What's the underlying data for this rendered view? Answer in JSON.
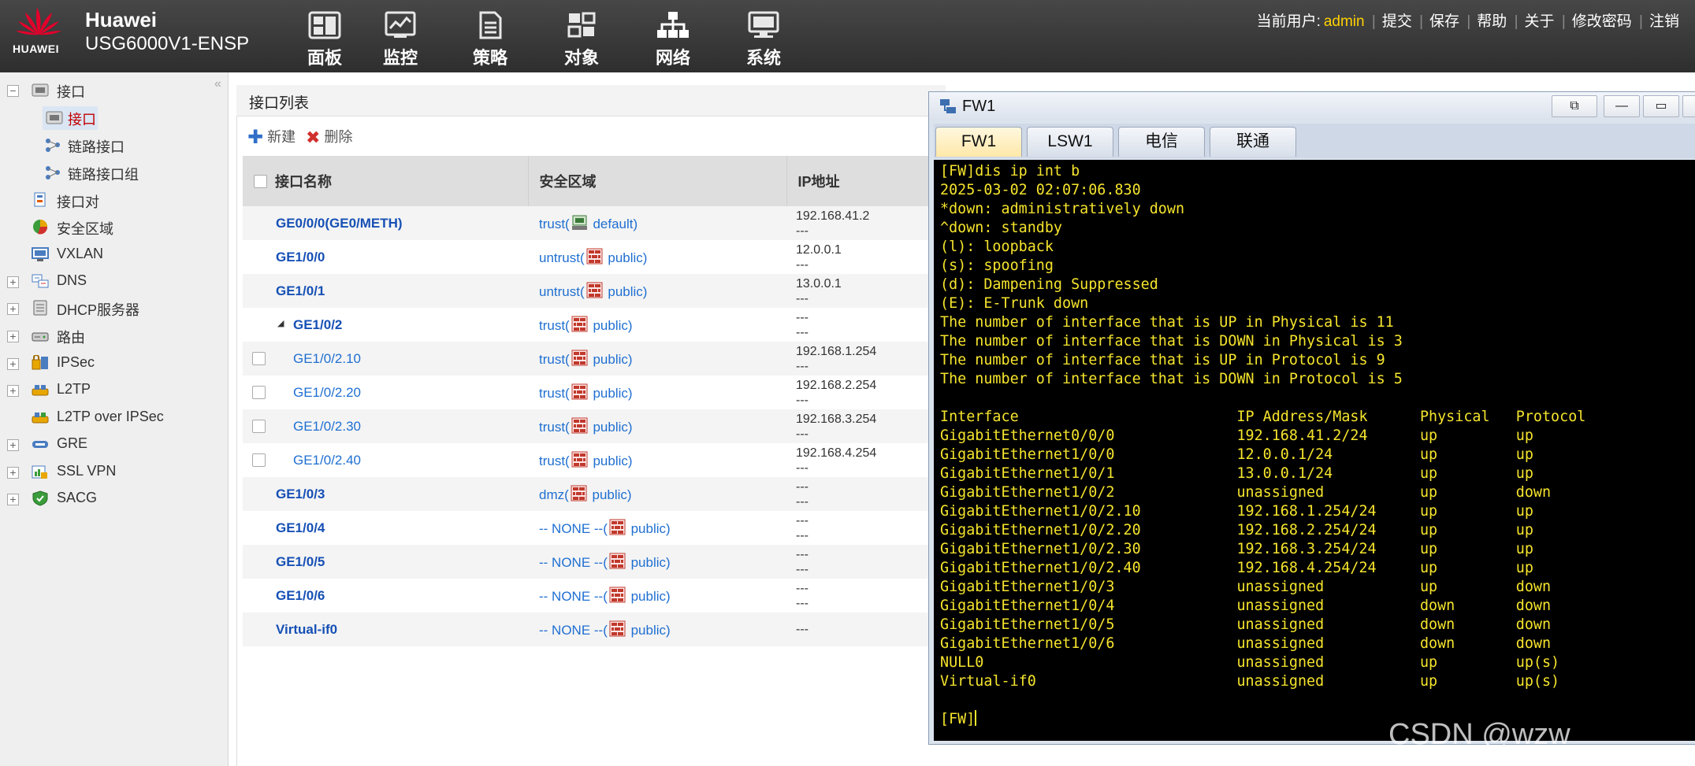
{
  "header": {
    "logo_text": "HUAWEI",
    "brand": "Huawei",
    "model": "USG6000V1-ENSP",
    "nav": [
      {
        "label": "面板",
        "icon": "dashboard-icon"
      },
      {
        "label": "监控",
        "icon": "monitor-icon"
      },
      {
        "label": "策略",
        "icon": "policy-icon"
      },
      {
        "label": "对象",
        "icon": "object-icon"
      },
      {
        "label": "网络",
        "icon": "network-icon"
      },
      {
        "label": "系统",
        "icon": "system-icon"
      }
    ],
    "user_label": "当前用户:",
    "user_name": "admin",
    "actions": [
      "提交",
      "保存",
      "帮助",
      "关于",
      "修改密码",
      "注销"
    ]
  },
  "sidebar": {
    "items": [
      {
        "label": "接口",
        "icon": "interface-folder-icon"
      },
      {
        "label": "接口",
        "icon": "interface-icon"
      },
      {
        "label": "链路接口",
        "icon": "link-interface-icon"
      },
      {
        "label": "链路接口组",
        "icon": "link-group-icon"
      },
      {
        "label": "接口对",
        "icon": "interface-pair-icon"
      },
      {
        "label": "安全区域",
        "icon": "security-zone-icon"
      },
      {
        "label": "VXLAN",
        "icon": "vxlan-icon"
      },
      {
        "label": "DNS",
        "icon": "dns-icon"
      },
      {
        "label": "DHCP服务器",
        "icon": "dhcp-icon"
      },
      {
        "label": "路由",
        "icon": "route-icon"
      },
      {
        "label": "IPSec",
        "icon": "ipsec-icon"
      },
      {
        "label": "L2TP",
        "icon": "l2tp-icon"
      },
      {
        "label": "L2TP over IPSec",
        "icon": "l2tp-ipsec-icon"
      },
      {
        "label": "GRE",
        "icon": "gre-icon"
      },
      {
        "label": "SSL VPN",
        "icon": "sslvpn-icon"
      },
      {
        "label": "SACG",
        "icon": "sacg-icon"
      }
    ],
    "collapse_glyph": "«"
  },
  "main": {
    "title": "接口列表",
    "toolbar": {
      "new_label": "新建",
      "delete_label": "删除"
    },
    "columns": [
      "接口名称",
      "安全区域",
      "IP地址"
    ],
    "rows": [
      {
        "name": "GE0/0/0(GE0/METH)",
        "zone": "trust(",
        "vsys": " default)",
        "ip1": "192.168.41.2",
        "ip2": "---"
      },
      {
        "name": "GE1/0/0",
        "zone": "untrust(",
        "vsys": " public)",
        "ip1": "12.0.0.1",
        "ip2": "---"
      },
      {
        "name": "GE1/0/1",
        "zone": "untrust(",
        "vsys": " public)",
        "ip1": "13.0.0.1",
        "ip2": "---"
      },
      {
        "name": "GE1/0/2",
        "zone": "trust(",
        "vsys": " public)",
        "ip1": "---",
        "ip2": "---"
      },
      {
        "name": "GE1/0/2.10",
        "zone": "trust(",
        "vsys": " public)",
        "ip1": "192.168.1.254",
        "ip2": "---"
      },
      {
        "name": "GE1/0/2.20",
        "zone": "trust(",
        "vsys": " public)",
        "ip1": "192.168.2.254",
        "ip2": "---"
      },
      {
        "name": "GE1/0/2.30",
        "zone": "trust(",
        "vsys": " public)",
        "ip1": "192.168.3.254",
        "ip2": "---"
      },
      {
        "name": "GE1/0/2.40",
        "zone": "trust(",
        "vsys": " public)",
        "ip1": "192.168.4.254",
        "ip2": "---"
      },
      {
        "name": "GE1/0/3",
        "zone": "dmz(",
        "vsys": " public)",
        "ip1": "---",
        "ip2": "---"
      },
      {
        "name": "GE1/0/4",
        "zone": "-- NONE --(",
        "vsys": " public)",
        "ip1": "---",
        "ip2": "---"
      },
      {
        "name": "GE1/0/5",
        "zone": "-- NONE --(",
        "vsys": " public)",
        "ip1": "---",
        "ip2": "---"
      },
      {
        "name": "GE1/0/6",
        "zone": "-- NONE --(",
        "vsys": " public)",
        "ip1": "---",
        "ip2": "---"
      },
      {
        "name": "Virtual-if0",
        "zone": "-- NONE --(",
        "vsys": " public)",
        "ip1": "---",
        "ip2": ""
      }
    ]
  },
  "terminal_window": {
    "title": "FW1",
    "tabs": [
      "FW1",
      "LSW1",
      "电信",
      "联通"
    ],
    "lines": [
      "[FW]dis ip int b",
      "2025-03-02 02:07:06.830",
      "*down: administratively down",
      "^down: standby",
      "(l): loopback",
      "(s): spoofing",
      "(d): Dampening Suppressed",
      "(E): E-Trunk down",
      "The number of interface that is UP in Physical is 11",
      "The number of interface that is DOWN in Physical is 3",
      "The number of interface that is UP in Protocol is 9",
      "The number of interface that is DOWN in Protocol is 5",
      "",
      "Interface                         IP Address/Mask      Physical   Protocol",
      "GigabitEthernet0/0/0              192.168.41.2/24      up         up",
      "GigabitEthernet1/0/0              12.0.0.1/24          up         up",
      "GigabitEthernet1/0/1              13.0.0.1/24          up         up",
      "GigabitEthernet1/0/2              unassigned           up         down",
      "GigabitEthernet1/0/2.10           192.168.1.254/24     up         up",
      "GigabitEthernet1/0/2.20           192.168.2.254/24     up         up",
      "GigabitEthernet1/0/2.30           192.168.3.254/24     up         up",
      "GigabitEthernet1/0/2.40           192.168.4.254/24     up         up",
      "GigabitEthernet1/0/3              unassigned           up         down",
      "GigabitEthernet1/0/4              unassigned           down       down",
      "GigabitEthernet1/0/5              unassigned           down       down",
      "GigabitEthernet1/0/6              unassigned           down       down",
      "NULL0                             unassigned           up         up(s)",
      "Virtual-if0                       unassigned           up         up(s)",
      "",
      "[FW]"
    ]
  },
  "watermark": "CSDN @wzw",
  "colors": {
    "accent_link": "#1f6fd1",
    "selected_item": "#c00000",
    "terminal_text": "#f5e42d",
    "user_name": "#ffd200"
  }
}
